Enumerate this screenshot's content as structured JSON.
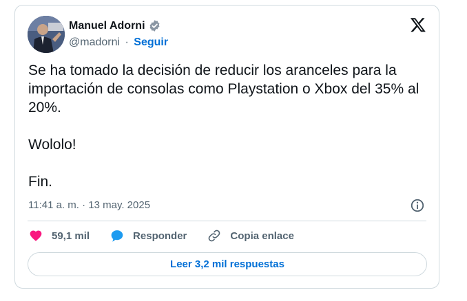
{
  "author": {
    "name": "Manuel Adorni",
    "handle": "@madorni",
    "separator": "·",
    "follow_label": "Seguir"
  },
  "tweet": {
    "text": "Se ha tomado la decisión de reducir los aranceles para la importación de consolas como Playstation o Xbox del 35% al 20%.\n\nWololo!\n\nFin.",
    "timestamp": "11:41 a. m. · 13 may. 2025"
  },
  "actions": {
    "likes": "59,1 mil",
    "reply_label": "Responder",
    "copy_link_label": "Copia enlace"
  },
  "replies_button": "Leer 3,2 mil respuestas",
  "icons": {
    "verified": "verified-badge-icon",
    "platform": "x-logo-icon",
    "info": "info-icon",
    "like": "heart-icon",
    "reply": "speech-bubble-icon",
    "link": "link-icon"
  },
  "colors": {
    "accent": "#006fd6",
    "like": "#f91880",
    "reply": "#1d9bf0",
    "muted": "#536471",
    "text": "#0f1419",
    "border": "#cfd9de"
  }
}
